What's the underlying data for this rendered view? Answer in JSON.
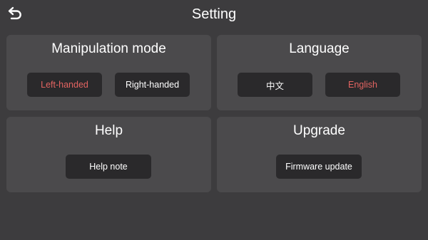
{
  "header": {
    "title": "Setting",
    "back_icon": "undo-arrow-icon"
  },
  "colors": {
    "accent": "#e36461",
    "background": "#3d3c3e",
    "panel": "#4b4a4c",
    "button": "#2a292b"
  },
  "panels": {
    "manipulation": {
      "title": "Manipulation mode",
      "left_label": "Left-handed",
      "right_label": "Right-handed",
      "selected": "Left-handed"
    },
    "language": {
      "title": "Language",
      "chinese_label": "中文",
      "english_label": "English",
      "selected": "English"
    },
    "help": {
      "title": "Help",
      "note_label": "Help note"
    },
    "upgrade": {
      "title": "Upgrade",
      "firmware_label": "Firmware update"
    }
  }
}
